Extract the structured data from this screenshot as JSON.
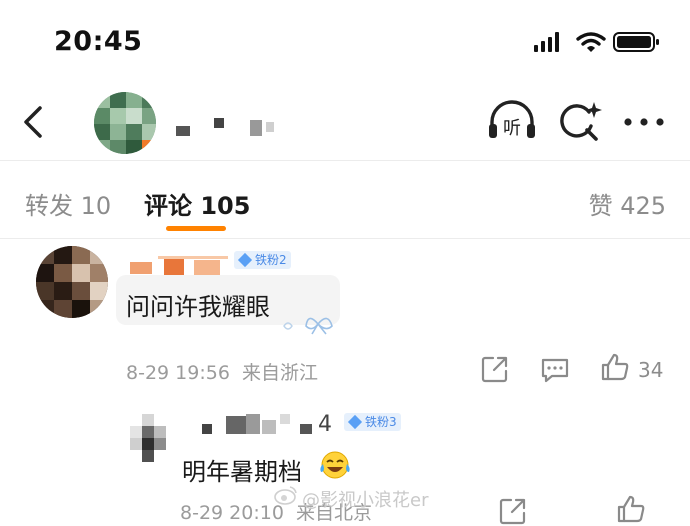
{
  "status_bar": {
    "time": "20:45"
  },
  "nav": {
    "back_icon": "chevron-left-icon",
    "listen_icon": "headphones-icon",
    "listen_label": "听",
    "search_icon": "search-icon",
    "more_icon": "more-icon"
  },
  "tabs": {
    "repost": "转发 10",
    "comment": "评论 105",
    "like": "赞 425",
    "accent": "#ff8200"
  },
  "comments": [
    {
      "badge": "铁粉2",
      "text": "问问许我耀眼",
      "time": "8-29 19:56",
      "location": "来自浙江",
      "likes": "34"
    },
    {
      "name_tail": "4",
      "badge": "铁粉3",
      "text": "明年暑期档",
      "time": "8-29 20:10",
      "location": "来自北京"
    }
  ],
  "watermark": "@影视小浪花er"
}
